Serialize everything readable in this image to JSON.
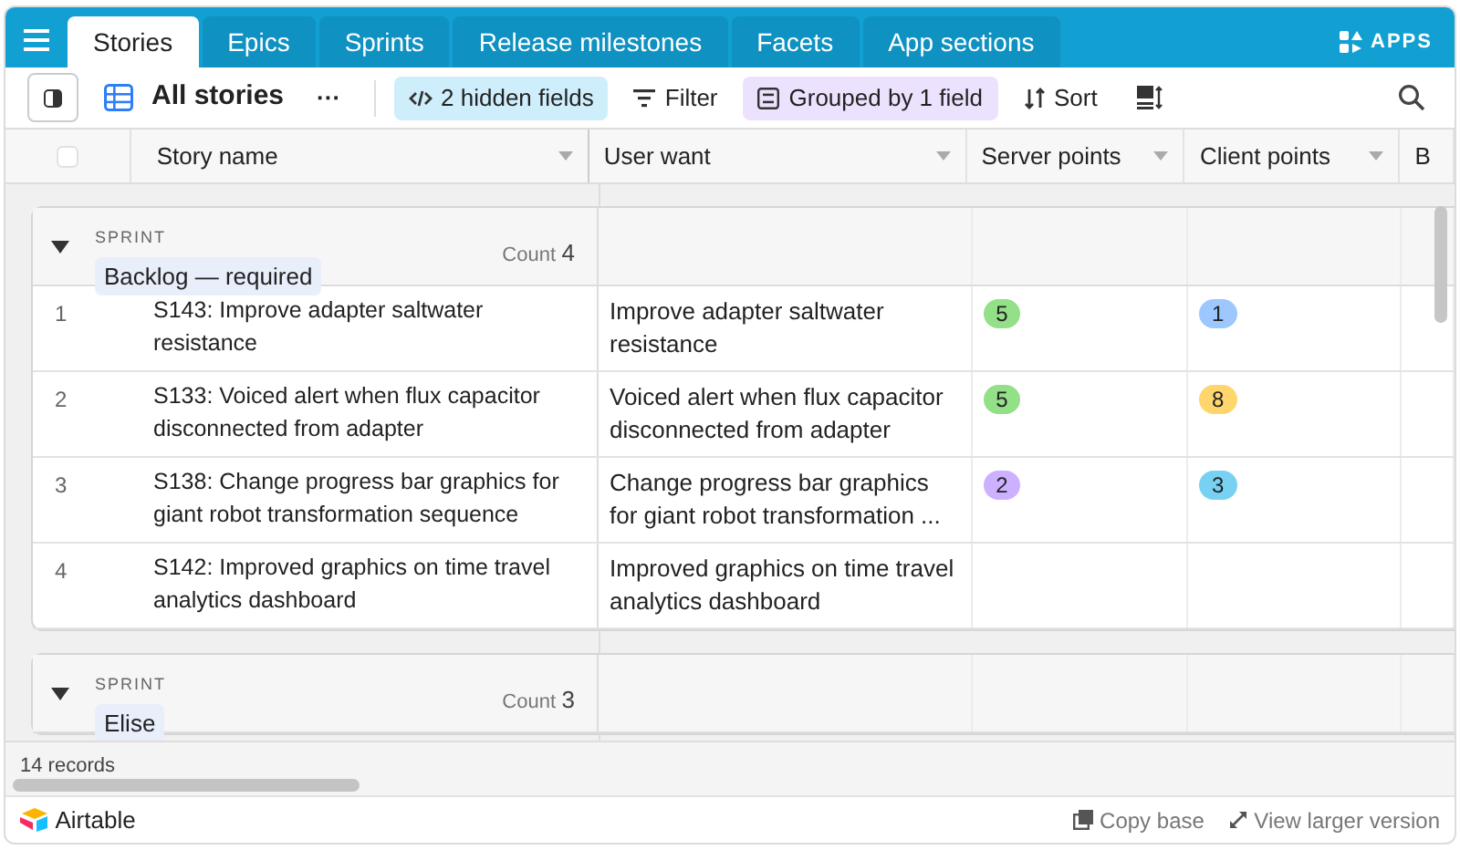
{
  "tabs": [
    {
      "label": "Stories",
      "selected": true
    },
    {
      "label": "Epics",
      "selected": false
    },
    {
      "label": "Sprints",
      "selected": false
    },
    {
      "label": "Release milestones",
      "selected": false
    },
    {
      "label": "Facets",
      "selected": false
    },
    {
      "label": "App sections",
      "selected": false
    }
  ],
  "apps_label": "APPS",
  "toolbar": {
    "view_name": "All stories",
    "more": "···",
    "hidden_fields": "2 hidden fields",
    "filter": "Filter",
    "grouped": "Grouped by 1 field",
    "sort": "Sort"
  },
  "table": {
    "columns": [
      "Story name",
      "User want",
      "Server points",
      "Client points",
      "B"
    ],
    "groups": [
      {
        "field_label": "SPRINT",
        "name": "Backlog — required",
        "count_label": "Count",
        "count": "4",
        "expanded": true,
        "rows": [
          {
            "number": "1",
            "story_name": "S143: Improve adapter saltwater resistance",
            "user_want": "Improve adapter saltwater resistance",
            "server_points": {
              "text": "5",
              "color": "#93e088"
            },
            "client_points": {
              "text": "1",
              "color": "#9cc7ff"
            }
          },
          {
            "number": "2",
            "story_name": "S133: Voiced alert when flux capacitor disconnected from adapter",
            "user_want": "Voiced alert when flux capacitor disconnected from adapter",
            "server_points": {
              "text": "5",
              "color": "#93e088"
            },
            "client_points": {
              "text": "8",
              "color": "#ffd66e"
            }
          },
          {
            "number": "3",
            "story_name": "S138: Change progress bar graphics for giant robot transformation sequence",
            "user_want": "Change progress bar graphics for giant robot transformation ...",
            "server_points": {
              "text": "2",
              "color": "#cdb0ff"
            },
            "client_points": {
              "text": "3",
              "color": "#77d1f3"
            }
          },
          {
            "number": "4",
            "story_name": "S142: Improved graphics on time travel analytics dashboard",
            "user_want": "Improved graphics on time travel analytics dashboard"
          }
        ]
      },
      {
        "field_label": "SPRINT",
        "name": "Elise",
        "count_label": "Count",
        "count": "3",
        "expanded": true
      }
    ],
    "select_all": {
      "checked": false
    }
  },
  "footer": {
    "records": "14 records"
  },
  "bottom_bar": {
    "brand": "Airtable",
    "links": [
      "Copy base",
      "View larger version"
    ]
  }
}
